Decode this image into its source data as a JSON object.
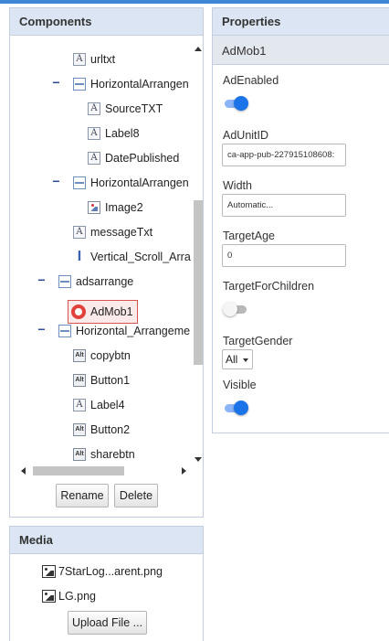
{
  "components": {
    "title": "Components",
    "tree": [
      {
        "label": "urltxt",
        "icon": "label-icon"
      },
      {
        "label": "HorizontalArrangen",
        "icon": "horizontal-arrangement-icon",
        "toggle": "−"
      },
      {
        "label": "SourceTXT",
        "icon": "label-icon"
      },
      {
        "label": "Label8",
        "icon": "label-icon"
      },
      {
        "label": "DatePublished",
        "icon": "label-icon"
      },
      {
        "label": "HorizontalArrangen",
        "icon": "horizontal-arrangement-icon",
        "toggle": "−"
      },
      {
        "label": "Image2",
        "icon": "image-icon"
      },
      {
        "label": "messageTxt",
        "icon": "label-icon"
      },
      {
        "label": "Vertical_Scroll_Arra",
        "icon": "vertical-scroll-icon"
      },
      {
        "label": "adsarrange",
        "icon": "horizontal-arrangement-icon",
        "toggle": "−"
      },
      {
        "label": "AdMob1",
        "icon": "admob-icon",
        "selected": true
      },
      {
        "label": "Horizontal_Arrangeme",
        "icon": "horizontal-arrangement-icon",
        "toggle": "−"
      },
      {
        "label": "copybtn",
        "icon": "button-icon"
      },
      {
        "label": "Button1",
        "icon": "button-icon"
      },
      {
        "label": "Label4",
        "icon": "label-icon"
      },
      {
        "label": "Button2",
        "icon": "button-icon"
      },
      {
        "label": "sharebtn",
        "icon": "button-icon"
      }
    ],
    "rename_label": "Rename",
    "delete_label": "Delete"
  },
  "properties": {
    "title": "Properties",
    "component_name": "AdMob1",
    "ad_enabled_label": "AdEnabled",
    "ad_enabled": true,
    "ad_unit_id_label": "AdUnitID",
    "ad_unit_id_value": "ca-app-pub-227915108608:",
    "width_label": "Width",
    "width_value": "Automatic...",
    "target_age_label": "TargetAge",
    "target_age_value": "0",
    "target_for_children_label": "TargetForChildren",
    "target_for_children": false,
    "target_gender_label": "TargetGender",
    "target_gender_value": "All",
    "visible_label": "Visible",
    "visible": true
  },
  "media": {
    "title": "Media",
    "files": [
      "7StarLog...arent.png",
      "LG.png"
    ],
    "upload_label": "Upload File ..."
  },
  "colors": {
    "accent_blue": "#1a73e8",
    "header_bg": "#dbe5f4",
    "selected_border": "#d9534f"
  }
}
